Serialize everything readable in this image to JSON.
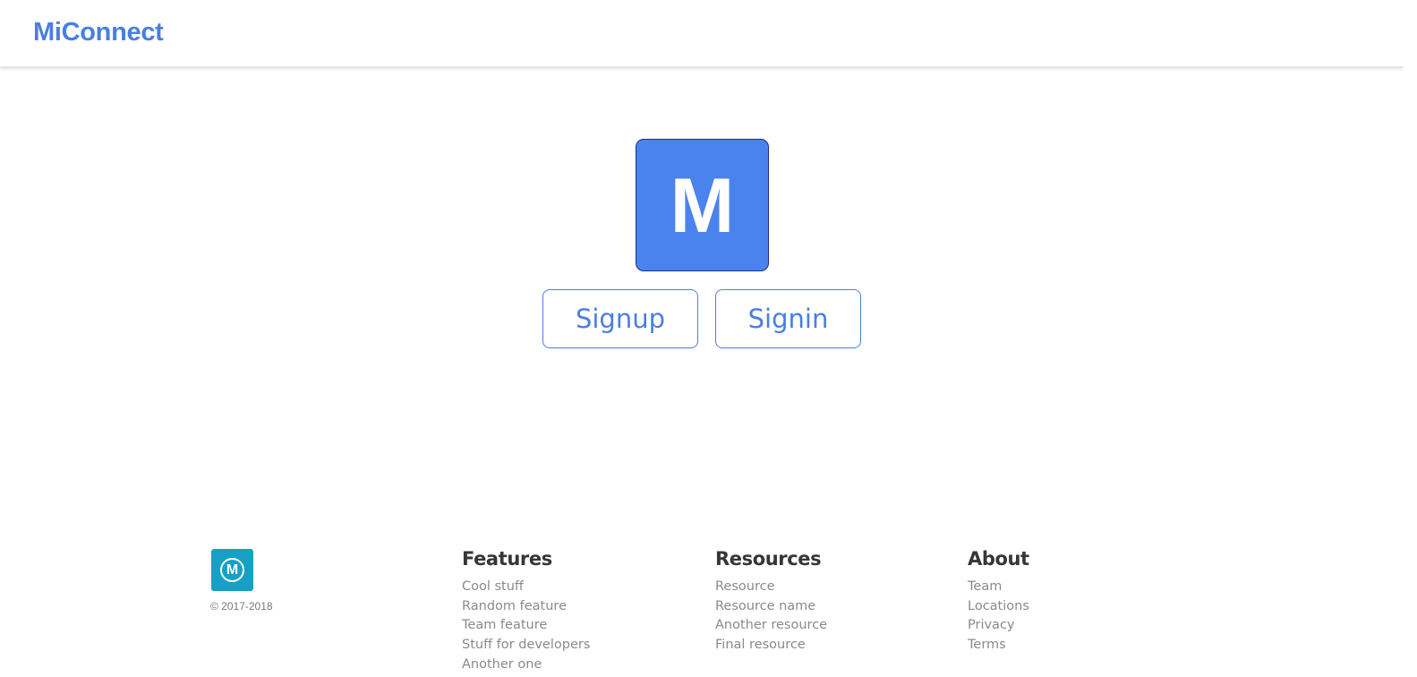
{
  "navbar": {
    "brand": "MiConnect"
  },
  "hero": {
    "logo_letter": "M",
    "signup_label": "Signup",
    "signin_label": "Signin"
  },
  "footer": {
    "logo_letter": "M",
    "copyright": "© 2017-2018",
    "columns": [
      {
        "title": "Features",
        "links": [
          "Cool stuff",
          "Random feature",
          "Team feature",
          "Stuff for developers",
          "Another one"
        ]
      },
      {
        "title": "Resources",
        "links": [
          "Resource",
          "Resource name",
          "Another resource",
          "Final resource"
        ]
      },
      {
        "title": "About",
        "links": [
          "Team",
          "Locations",
          "Privacy",
          "Terms"
        ]
      }
    ]
  },
  "colors": {
    "brand": "#4a7fe0",
    "hero_logo_bg": "#4a83ed",
    "footer_logo_bg": "#16a0c4"
  }
}
